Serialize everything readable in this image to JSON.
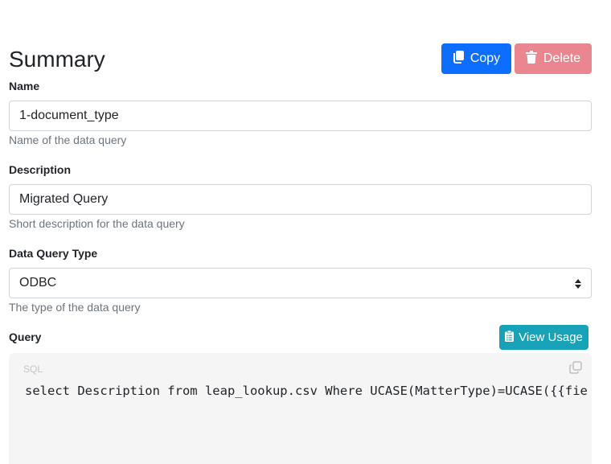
{
  "header": {
    "title": "Summary",
    "copy_label": "Copy",
    "delete_label": "Delete"
  },
  "name": {
    "label": "Name",
    "value": "1-document_type",
    "help": "Name of the data query"
  },
  "description": {
    "label": "Description",
    "value": "Migrated Query",
    "help": "Short description for the data query"
  },
  "query_type": {
    "label": "Data Query Type",
    "selected": "ODBC",
    "help": "The type of the data query"
  },
  "query": {
    "label": "Query",
    "view_usage_label": "View Usage",
    "language": "SQL",
    "code": "select Description from leap_lookup.csv Where UCASE(MatterType)=UCASE({{fie"
  },
  "colors": {
    "primary": "#0d6efd",
    "danger_light": "#ea868f",
    "info": "#17a2b8",
    "code_bg": "#f5f5f5"
  },
  "icons": {
    "copy": "copy-icon",
    "delete": "trash-icon",
    "view_usage": "clipboard-list-icon",
    "select": "sort-caret-icon",
    "code_copy": "copy-outline-icon"
  }
}
